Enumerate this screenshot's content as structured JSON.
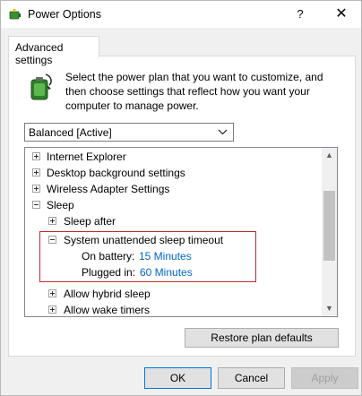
{
  "window": {
    "title": "Power Options",
    "help_glyph": "?",
    "close_glyph": "✕",
    "title_icon": "power-options-icon"
  },
  "tabs": [
    {
      "label": "Advanced settings",
      "selected": true
    }
  ],
  "description": {
    "line1": "Select the power plan that you want to customize, and",
    "line2": "then choose settings that reflect how you want your",
    "line3": "computer to manage power."
  },
  "plan_select": {
    "value": "Balanced [Active]"
  },
  "tree": {
    "internet_explorer": "Internet Explorer",
    "desktop_background": "Desktop background settings",
    "wireless_adapter": "Wireless Adapter Settings",
    "sleep": "Sleep",
    "sleep_after": "Sleep after",
    "system_unattended": "System unattended sleep timeout",
    "on_battery_label": "On battery:",
    "on_battery_value": "15 Minutes",
    "plugged_in_label": "Plugged in:",
    "plugged_in_value": "60 Minutes",
    "allow_hybrid": "Allow hybrid sleep",
    "allow_wake": "Allow wake timers"
  },
  "buttons": {
    "restore": "Restore plan defaults",
    "ok": "OK",
    "cancel": "Cancel",
    "apply": "Apply"
  },
  "colors": {
    "link": "#0066cc",
    "highlight_border": "#c0282c",
    "ok_border": "#0078d7"
  }
}
